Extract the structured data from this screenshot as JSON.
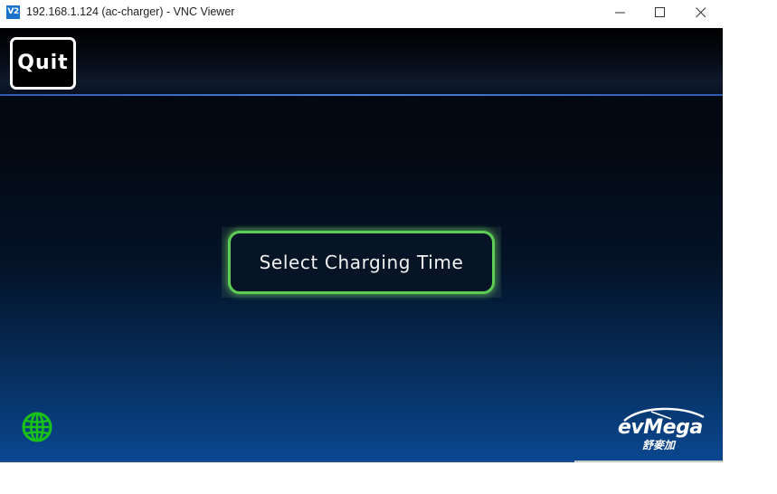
{
  "window": {
    "icon_text": "V2",
    "title": "192.168.1.124 (ac-charger) - VNC Viewer",
    "controls": {
      "minimize": "minimize-icon",
      "maximize": "maximize-icon",
      "close": "close-icon"
    }
  },
  "charger_ui": {
    "quit_label": "Quit",
    "select_label": "Select Charging Time",
    "language_icon": "globe-icon",
    "logo": {
      "brand": "evMega",
      "sub": "舒麥加"
    },
    "colors": {
      "accent_green": "#5dcc55",
      "globe_green": "#19c219",
      "header_line_blue": "#4d7fdc"
    }
  }
}
